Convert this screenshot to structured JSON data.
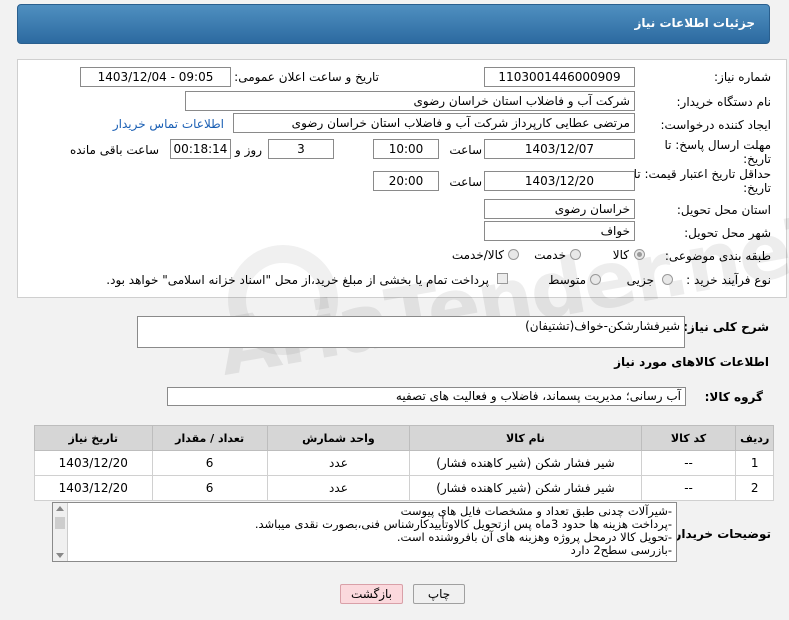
{
  "header": {
    "title": "جزئیات اطلاعات نیاز"
  },
  "form": {
    "need_number": {
      "label": "شماره نیاز:",
      "value": "1103001446000909"
    },
    "announce": {
      "label": "تاریخ و ساعت اعلان عمومی:",
      "value": "1403/12/04 - 09:05"
    },
    "buyer_org": {
      "label": "نام دستگاه خریدار:",
      "value": "شرکت آب و فاضلاب استان خراسان رضوی"
    },
    "requester": {
      "label": "ایجاد کننده درخواست:",
      "value": "مرتضی عطایی کارپرداز شرکت آب و فاضلاب استان خراسان رضوی",
      "contact_link": "اطلاعات تماس خریدار"
    },
    "deadline": {
      "label": "مهلت ارسال پاسخ: تا تاریخ:",
      "date": "1403/12/07",
      "time_label": "ساعت",
      "time": "10:00",
      "days": "3",
      "days_label": "روز و",
      "remaining": "00:18:14",
      "remaining_label": "ساعت باقی مانده"
    },
    "price_validity": {
      "label": "حداقل تاریخ اعتبار قیمت: تا تاریخ:",
      "date": "1403/12/20",
      "time_label": "ساعت",
      "time": "20:00"
    },
    "delivery_province": {
      "label": "استان محل تحویل:",
      "value": "خراسان رضوی"
    },
    "delivery_city": {
      "label": "شهر محل تحویل:",
      "value": "خواف"
    },
    "category": {
      "label": "طبقه بندی موضوعی:",
      "options": [
        "کالا",
        "خدمت",
        "کالا/خدمت"
      ],
      "selected": "کالا"
    },
    "process": {
      "label": "نوع فرآیند خرید :",
      "options": [
        "جزیی",
        "متوسط"
      ],
      "payment_note": "پرداخت تمام یا بخشی از مبلغ خرید،از محل \"اسناد خزانه اسلامی\" خواهد بود."
    }
  },
  "summary": {
    "label": "شرح کلی نیاز:",
    "value": "شیرفشارشکن-خواف(تشتیفان)"
  },
  "goods": {
    "section_title": "اطلاعات کالاهای مورد نیاز",
    "group_label": "گروه کالا:",
    "group_value": "آب رسانی؛ مدیریت پسماند، فاضلاب و فعالیت های تصفیه",
    "columns": [
      "ردیف",
      "کد کالا",
      "نام کالا",
      "واحد شمارش",
      "تعداد / مقدار",
      "تاریخ نیاز"
    ],
    "rows": [
      [
        "1",
        "--",
        "شیر فشار شکن (شیر کاهنده فشار)",
        "عدد",
        "6",
        "1403/12/20"
      ],
      [
        "2",
        "--",
        "شیر فشار شکن (شیر کاهنده فشار)",
        "عدد",
        "6",
        "1403/12/20"
      ]
    ]
  },
  "buyer_notes": {
    "label": "توضیحات خریدار:",
    "lines": [
      "-شیرآلات چدنی طبق تعداد و مشخصات فایل های پیوست",
      "-پرداخت هزینه ها حدود 3ماه پس ازتحویل کالاوتأییدکارشناس فنی،بصورت نقدی میباشد.",
      "-تحویل کالا درمحل پروژه وهزینه های آن بافروشنده است.",
      "-بازرسی سطح2 دارد"
    ]
  },
  "buttons": {
    "print": "چاپ",
    "back": "بازگشت"
  },
  "watermark": "AriaTender.neT"
}
